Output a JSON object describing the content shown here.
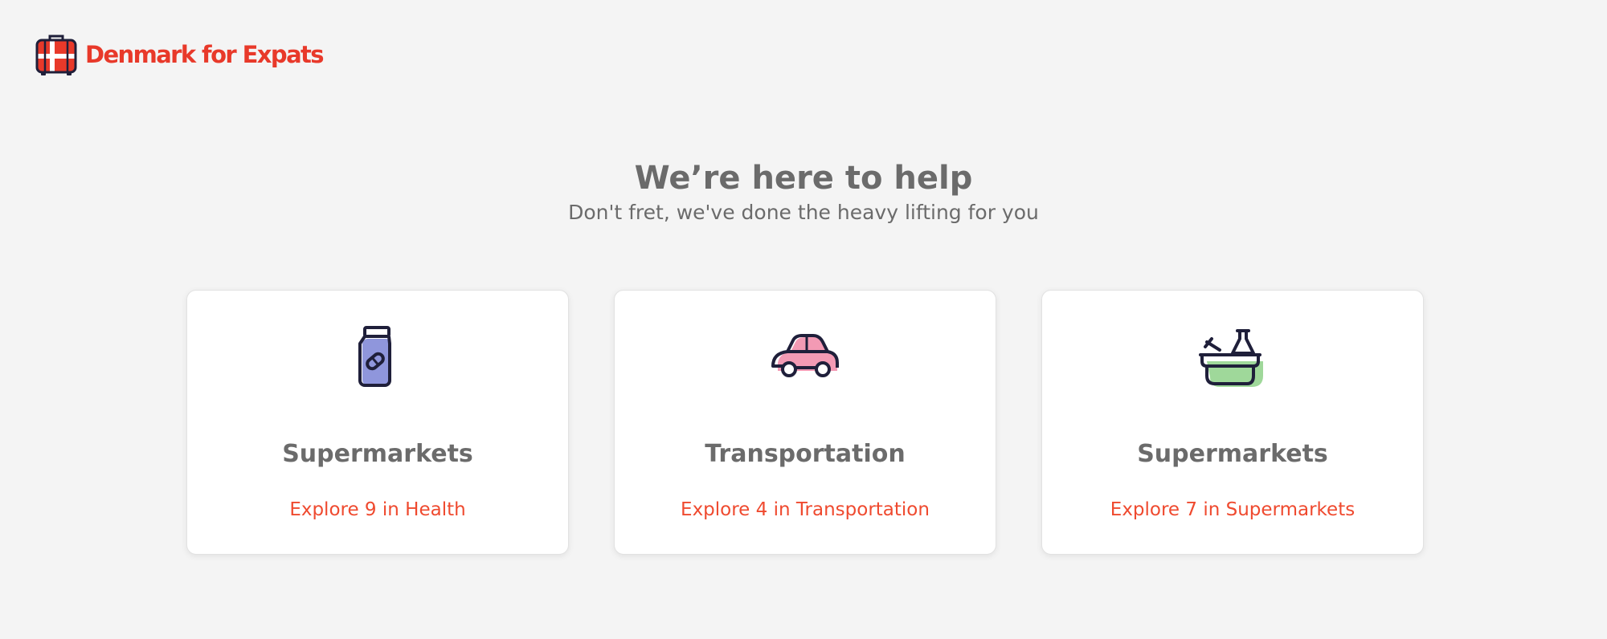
{
  "header": {
    "logo_text": "Denmark for Expats",
    "logo_icon": "suitcase-icon"
  },
  "hero": {
    "title": "We’re here to help",
    "subtitle": "Don't fret, we've done the heavy lifting for you"
  },
  "cards": [
    {
      "icon": "medicine-jar-icon",
      "icon_accent": "#8f96dc",
      "title": "Supermarkets",
      "link": "Explore 9 in Health"
    },
    {
      "icon": "car-icon",
      "icon_accent": "#f39ab4",
      "title": "Transportation",
      "link": "Explore 4 in Transportation"
    },
    {
      "icon": "grocery-basket-icon",
      "icon_accent": "#9fd89a",
      "title": "Supermarkets",
      "link": "Explore 7 in Supermarkets"
    }
  ],
  "colors": {
    "brand": "#e8392a",
    "link": "#ef4a2f",
    "text": "#6b6b6b",
    "background": "#f4f4f4",
    "icon_stroke": "#1f1f3a"
  }
}
